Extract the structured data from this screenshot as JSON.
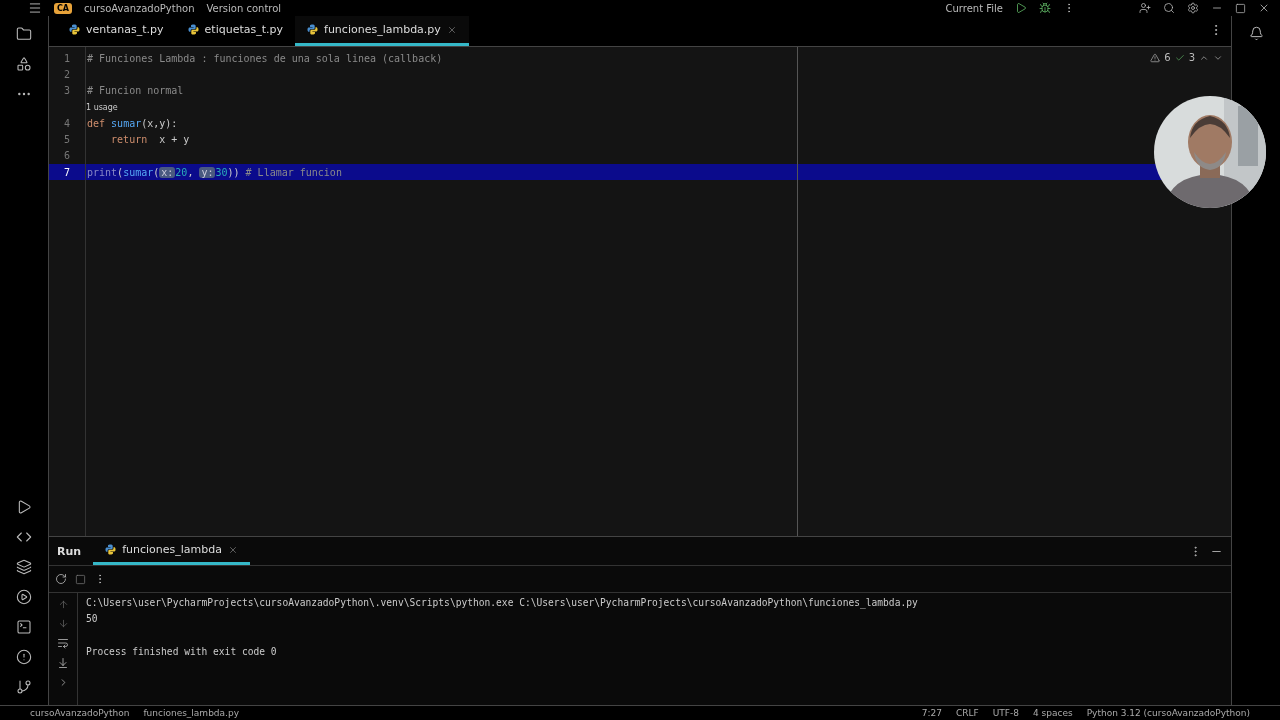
{
  "title_bar": {
    "project_badge": "CA",
    "project": "cursoAvanzadoPython",
    "vcs": "Version control",
    "run_config": "Current File"
  },
  "tabs": [
    {
      "label": "ventanas_t.py",
      "selected": false
    },
    {
      "label": "etiquetas_t.py",
      "selected": false
    },
    {
      "label": "funciones_lambda.py",
      "selected": true
    }
  ],
  "inspections": {
    "warnings": "6",
    "checks": "3"
  },
  "editor": {
    "lines": [
      {
        "number": "1",
        "selected": false,
        "tokens": [
          {
            "kind": "comment",
            "text": "# Funciones Lambda : funciones de una sola linea (callback)"
          }
        ]
      },
      {
        "number": "2",
        "selected": false
      },
      {
        "number": "3",
        "selected": false,
        "tokens": [
          {
            "kind": "comment",
            "text": "# Funcion normal"
          }
        ]
      },
      {
        "number": "4",
        "selected": false,
        "usage": "1 usage",
        "tokens": [
          {
            "kind": "keyword",
            "text": "def "
          },
          {
            "kind": "function",
            "text": "sumar"
          },
          {
            "kind": "plain",
            "text": "(x,y):"
          }
        ]
      },
      {
        "number": "5",
        "selected": false,
        "tokens": [
          {
            "kind": "keyword",
            "text": "    return"
          },
          {
            "kind": "plain",
            "text": "  x + y"
          }
        ]
      },
      {
        "number": "6",
        "selected": false
      },
      {
        "number": "7",
        "selected": true,
        "tokens": [
          {
            "kind": "builtin",
            "text": "print"
          },
          {
            "kind": "plain",
            "text": "("
          },
          {
            "kind": "function",
            "text": "sumar"
          },
          {
            "kind": "plain",
            "text": "("
          },
          {
            "kind": "hint",
            "text": "x:"
          },
          {
            "kind": "number",
            "text": "20"
          },
          {
            "kind": "plain",
            "text": ", "
          },
          {
            "kind": "hint",
            "text": "y:"
          },
          {
            "kind": "number",
            "text": "30"
          },
          {
            "kind": "plain",
            "text": "))"
          },
          {
            "kind": "comment",
            "text": " # Llamar funcion"
          }
        ]
      }
    ]
  },
  "run_panel": {
    "title": "Run",
    "tabs": [
      {
        "label": "funciones_lambda",
        "selected": true
      }
    ],
    "output": [
      "C:\\Users\\user\\PycharmProjects\\cursoAvanzadoPython\\.venv\\Scripts\\python.exe C:\\Users\\user\\PycharmProjects\\cursoAvanzadoPython\\funciones_lambda.py",
      "50"
    ],
    "exit_message": "Process finished with exit code 0"
  },
  "breadcrumbs": [
    "cursoAvanzadoPython",
    "funciones_lambda.py"
  ],
  "status_bar": [
    "7:27",
    "CRLF",
    "UTF-8",
    "4 spaces",
    "Python 3.12 (cursoAvanzadoPython)"
  ],
  "webcam": {
    "kind": "picture"
  }
}
